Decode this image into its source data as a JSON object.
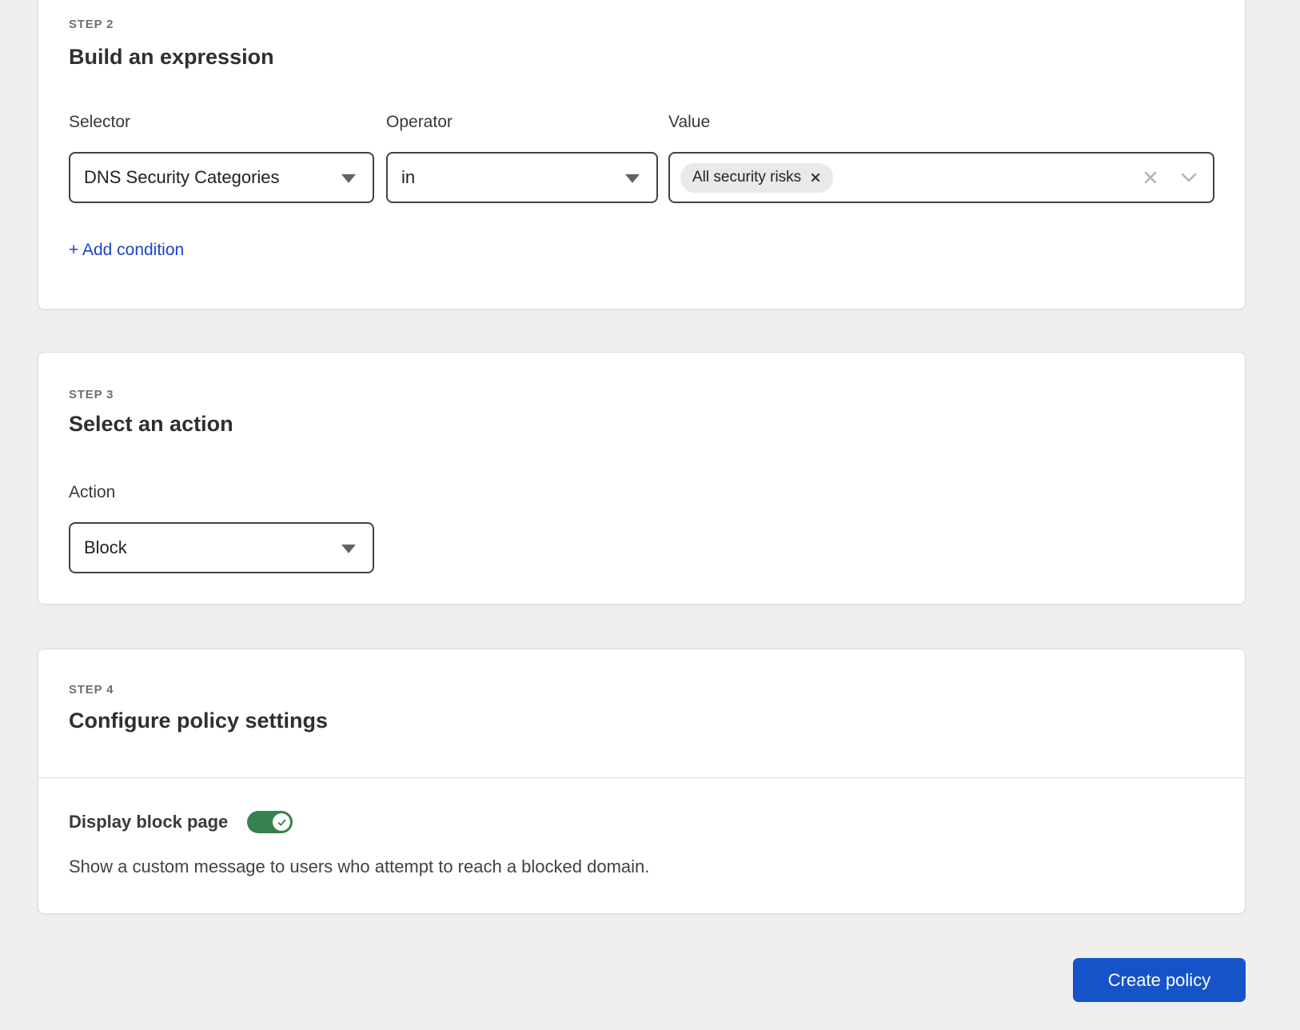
{
  "steps": {
    "step2": {
      "eyebrow": "STEP 2",
      "title": "Build an expression",
      "selector": {
        "label": "Selector",
        "value": "DNS Security Categories"
      },
      "operator": {
        "label": "Operator",
        "value": "in"
      },
      "value_field": {
        "label": "Value",
        "tags": [
          {
            "label": "All security risks"
          }
        ]
      },
      "add_condition_label": "+ Add condition"
    },
    "step3": {
      "eyebrow": "STEP 3",
      "title": "Select an action",
      "action": {
        "label": "Action",
        "value": "Block"
      }
    },
    "step4": {
      "eyebrow": "STEP 4",
      "title": "Configure policy settings",
      "toggle": {
        "label": "Display block page",
        "state": "on"
      },
      "description": "Show a custom message to users who attempt to reach a blocked domain."
    }
  },
  "footer": {
    "create_button_label": "Create policy"
  },
  "colors": {
    "page_background": "#f0efef",
    "accent_blue": "#1653c9",
    "link_blue": "#1d44c8",
    "toggle_green": "#35824e",
    "field_border": "#424242"
  }
}
